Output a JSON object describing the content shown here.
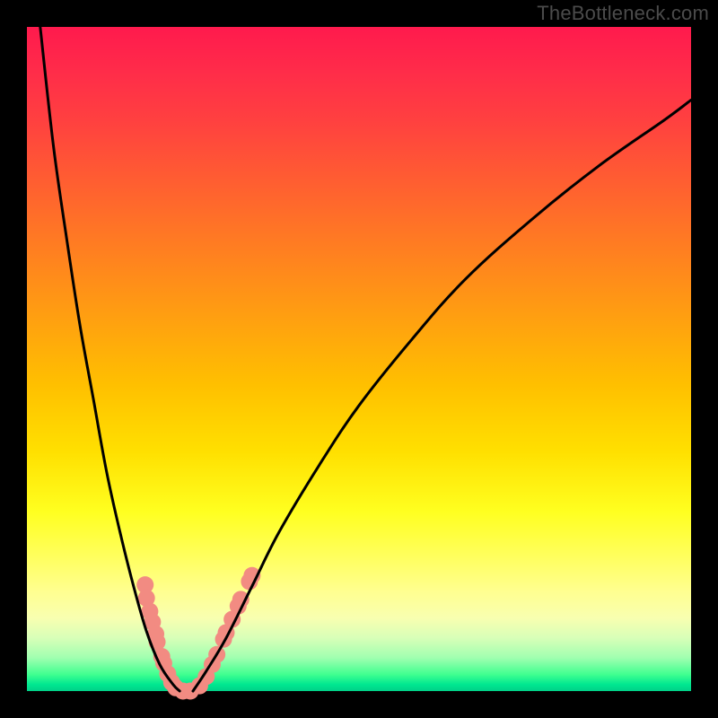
{
  "watermark": "TheBottleneck.com",
  "chart_data": {
    "type": "line",
    "title": "",
    "xlabel": "",
    "ylabel": "",
    "xlim": [
      0,
      100
    ],
    "ylim": [
      0,
      100
    ],
    "series": [
      {
        "name": "left-curve",
        "x": [
          2,
          4,
          6,
          8,
          10,
          12,
          14,
          16,
          18,
          20,
          22,
          23
        ],
        "y": [
          100,
          82,
          68,
          55,
          44,
          33,
          24,
          16,
          9,
          4,
          1,
          0
        ]
      },
      {
        "name": "right-curve",
        "x": [
          25,
          27,
          30,
          34,
          38,
          44,
          50,
          58,
          66,
          76,
          86,
          96,
          100
        ],
        "y": [
          0,
          3,
          8,
          16,
          24,
          34,
          43,
          53,
          62,
          71,
          79,
          86,
          89
        ]
      }
    ],
    "markers": [
      {
        "x": 17.8,
        "y": 16.0
      },
      {
        "x": 18.0,
        "y": 14.0
      },
      {
        "x": 18.5,
        "y": 12.0
      },
      {
        "x": 18.9,
        "y": 10.4
      },
      {
        "x": 19.4,
        "y": 8.6
      },
      {
        "x": 19.6,
        "y": 7.4
      },
      {
        "x": 20.3,
        "y": 5.2
      },
      {
        "x": 20.6,
        "y": 4.2
      },
      {
        "x": 21.2,
        "y": 2.6
      },
      {
        "x": 21.8,
        "y": 1.3
      },
      {
        "x": 22.4,
        "y": 0.5
      },
      {
        "x": 23.5,
        "y": 0.0
      },
      {
        "x": 24.6,
        "y": 0.0
      },
      {
        "x": 26.0,
        "y": 0.8
      },
      {
        "x": 27.0,
        "y": 2.2
      },
      {
        "x": 27.9,
        "y": 4.0
      },
      {
        "x": 28.6,
        "y": 5.5
      },
      {
        "x": 29.6,
        "y": 7.8
      },
      {
        "x": 30.0,
        "y": 8.8
      },
      {
        "x": 30.9,
        "y": 10.8
      },
      {
        "x": 31.8,
        "y": 12.8
      },
      {
        "x": 32.2,
        "y": 13.8
      },
      {
        "x": 33.5,
        "y": 16.5
      },
      {
        "x": 33.9,
        "y": 17.4
      }
    ],
    "marker_color": "#f28b82",
    "curve_color": "#000000"
  }
}
